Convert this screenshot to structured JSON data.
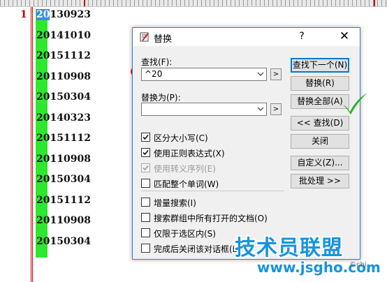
{
  "editor": {
    "line_number": "1",
    "lines": [
      {
        "prefix": "20",
        "rest": "130923"
      },
      {
        "prefix": "20",
        "rest": "141010"
      },
      {
        "prefix": "20",
        "rest": "151112"
      },
      {
        "prefix": "20",
        "rest": "110908"
      },
      {
        "prefix": "20",
        "rest": "150304"
      },
      {
        "prefix": "20",
        "rest": "140323"
      },
      {
        "prefix": "20",
        "rest": "151112"
      },
      {
        "prefix": "20",
        "rest": "110908"
      },
      {
        "prefix": "20",
        "rest": "150304"
      },
      {
        "prefix": "20",
        "rest": "151112"
      },
      {
        "prefix": "20",
        "rest": "110908"
      },
      {
        "prefix": "20",
        "rest": "150304"
      }
    ]
  },
  "dialog": {
    "title": "替换",
    "help": "?",
    "close": "✕",
    "find_label": "查找(F):",
    "find_value": "^20",
    "replace_label": "替换为(P):",
    "replace_value": "",
    "expand_button": ">",
    "buttons": {
      "find_next": "查找下一个(N)",
      "replace": "替换(R)",
      "replace_all": "替换全部(A)",
      "find_less": "<< 查找(D)",
      "close": "关闭",
      "customize": "自定义(Z)...",
      "batch": "批处理 >>"
    },
    "options": [
      {
        "label": "区分大小写(C)",
        "checked": true,
        "disabled": false
      },
      {
        "label": "使用正则表达式(X)",
        "checked": true,
        "disabled": false
      },
      {
        "label": "使用转义序列(E)",
        "checked": true,
        "disabled": true
      },
      {
        "label": "匹配整个单词(W)",
        "checked": false,
        "disabled": false
      }
    ],
    "extra_options": [
      {
        "label": "增量搜索(I)",
        "checked": false
      },
      {
        "label": "搜索群组中所有打开的文档(O)",
        "checked": false
      },
      {
        "label": "仅限于选区内(S)",
        "checked": false
      },
      {
        "label": "完成后关闭该对话框(L)",
        "checked": false
      }
    ]
  },
  "watermark": {
    "brand": "技术员联盟",
    "url": "www.jsgho.com",
    "small": "©chi"
  },
  "colors": {
    "accent": "#0078d7",
    "highlight_strip": "#2ee82e",
    "annotation_red": "#e8141f",
    "annotation_check": "#2bb52b",
    "watermark": "#1694e0"
  }
}
